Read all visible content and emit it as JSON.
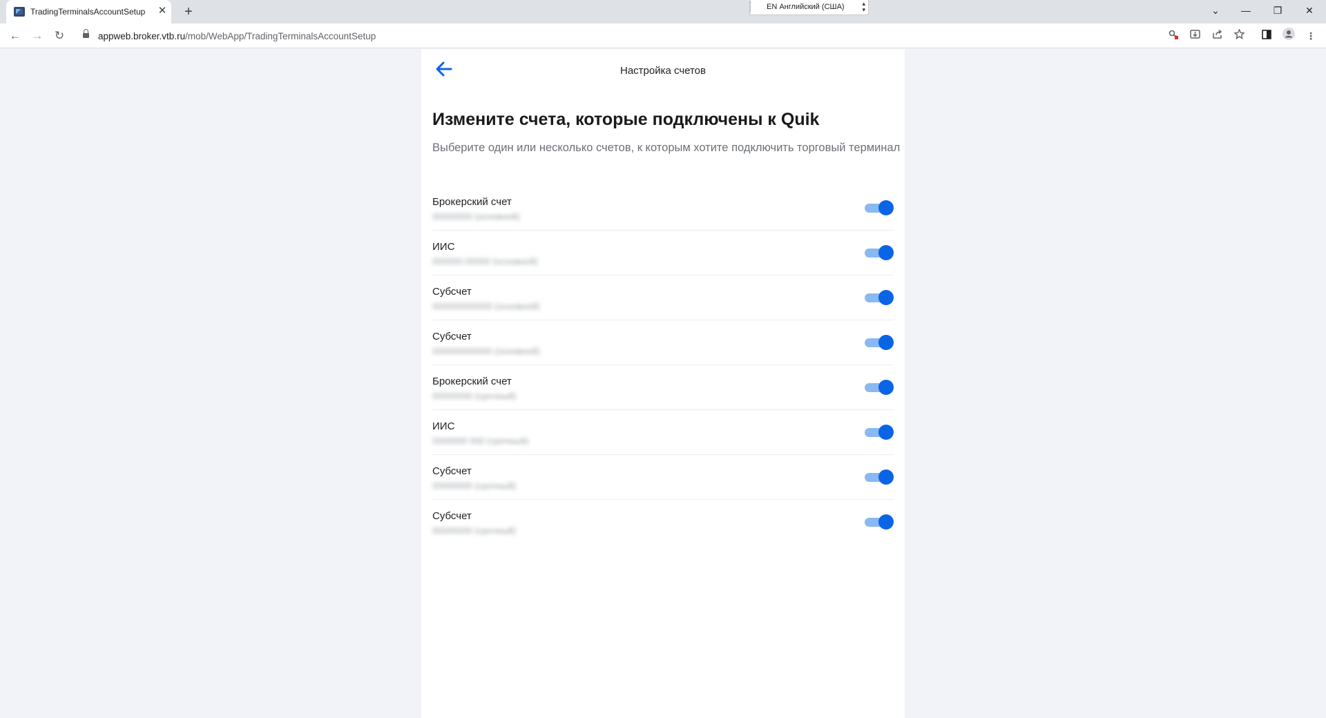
{
  "browser": {
    "tab_title": "TradingTerminalsAccountSetup",
    "tab_close": "✕",
    "new_tab": "+",
    "language": "EN Английский (США)",
    "url_host": "appweb.broker.vtb.ru",
    "url_path": "/mob/WebApp/TradingTerminalsAccountSetup",
    "window": {
      "minimize": "—",
      "restore": "❐",
      "close": "✕",
      "tabs_menu": "⌄"
    },
    "nav": {
      "back": "←",
      "forward": "→",
      "reload": "↻"
    },
    "toolbar_icons": [
      "password-key-icon",
      "install-app-icon",
      "share-icon",
      "bookmark-star-icon",
      "side-panel-icon",
      "profile-icon",
      "menu-icon"
    ]
  },
  "app": {
    "header_title": "Настройка счетов",
    "heading": "Измените счета, которые подключены к Quik",
    "subheading": "Выберите один или несколько счетов, к которым хотите подключить торговый терминал",
    "accent_color": "#0a64e6",
    "accounts": [
      {
        "title": "Брокерский счет",
        "number": "00000000 (основной)",
        "enabled": true
      },
      {
        "title": "ИИС",
        "number": "000000-00000 (основной)",
        "enabled": true
      },
      {
        "title": "Субсчет",
        "number": "000000000000 (основной)",
        "enabled": true
      },
      {
        "title": "Субсчет",
        "number": "000000000000 (основной)",
        "enabled": true
      },
      {
        "title": "Брокерский счет",
        "number": "00000000 (срочный)",
        "enabled": true
      },
      {
        "title": "ИИС",
        "number": "0000000 000 (срочный)",
        "enabled": true
      },
      {
        "title": "Субсчет",
        "number": "00000000 (срочный)",
        "enabled": true
      },
      {
        "title": "Субсчет",
        "number": "00000000 (срочный)",
        "enabled": true
      }
    ]
  }
}
